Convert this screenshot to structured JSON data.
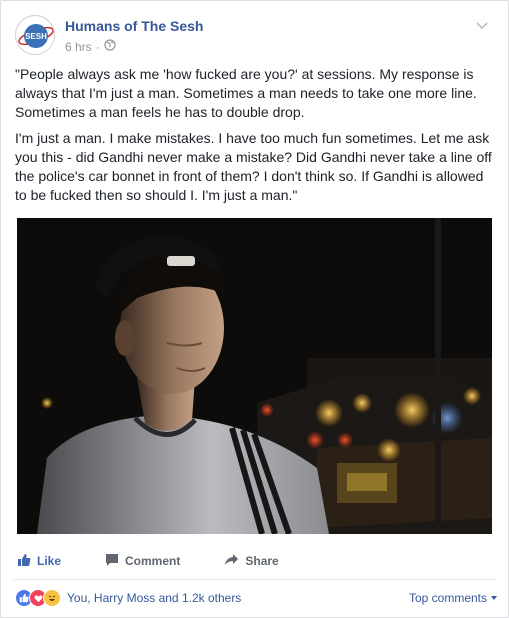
{
  "post": {
    "page_name": "Humans of The Sesh",
    "avatar_text": "SESH",
    "timestamp": "6 hrs",
    "audience_icon": "globe-icon",
    "paragraphs": [
      "\"People always ask me 'how fucked are you?' at sessions. My response is always that I'm just a man. Sometimes a man needs to take one more line. Sometimes a man feels he has to double drop.",
      "I'm just a man. I make mistakes. I have too much fun sometimes. Let me ask you this - did Gandhi never make a mistake? Did Gandhi never take a line off the police's car bonnet in front of them? I don't think so. If Gandhi is allowed to be fucked then so should I. I'm just a man.\""
    ]
  },
  "actions": {
    "like": "Like",
    "comment": "Comment",
    "share": "Share"
  },
  "reactions": {
    "summary": "You, Harry Moss and 1.2k others",
    "icons": [
      "like-reaction-icon",
      "love-reaction-icon",
      "haha-reaction-icon"
    ],
    "top_comments": "Top comments"
  },
  "colors": {
    "link_blue": "#365899",
    "like_blue": "#4267b2",
    "meta_gray": "#90949c",
    "avatar_blue": "#3b6fb6"
  }
}
